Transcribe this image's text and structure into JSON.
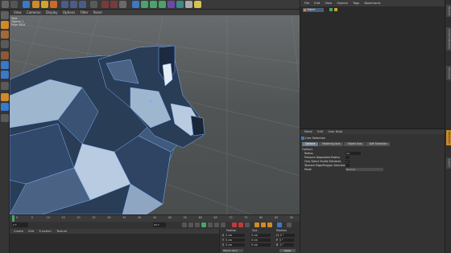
{
  "viewport": {
    "menu": [
      "View",
      "Cameras",
      "Display",
      "Options",
      "Filter",
      "Panel"
    ],
    "hud": [
      "Total",
      "Objects",
      "Polys"
    ],
    "hud_values": [
      "",
      "1",
      "3824"
    ]
  },
  "timeline": {
    "ticks": [
      "0",
      "5",
      "10",
      "15",
      "20",
      "25",
      "30",
      "35",
      "40",
      "45",
      "50",
      "55",
      "60",
      "65",
      "70",
      "75",
      "80",
      "85",
      "90"
    ],
    "current_frame": "0 F",
    "start_frame": "0 F",
    "end_frame": "90 F"
  },
  "material_menu": [
    "Create",
    "Edit",
    "Function",
    "Texture"
  ],
  "coords": {
    "headers": [
      "Position",
      "Size",
      "Rotation"
    ],
    "rows": [
      {
        "axis": "X",
        "pos": "0 cm",
        "size": "0 cm",
        "rot_label": "H",
        "rot": "0 °"
      },
      {
        "axis": "Y",
        "pos": "0 cm",
        "size": "0 cm",
        "rot_label": "P",
        "rot": "0 °"
      },
      {
        "axis": "Z",
        "pos": "0 cm",
        "size": "0 cm",
        "rot_label": "B",
        "rot": "0 °"
      }
    ],
    "mode": "Object (Rel)",
    "apply": "Apply"
  },
  "object_manager": {
    "menu": [
      "File",
      "Edit",
      "View",
      "Objects",
      "Tags",
      "Bookmarks"
    ],
    "header": "Object"
  },
  "attributes": {
    "menu": [
      "Mode",
      "Edit",
      "User Data"
    ],
    "title": "Live Selection",
    "tabs": [
      "Options",
      "Modeling Axis",
      "Object Axis",
      "Soft Selection"
    ],
    "section": "Options",
    "rows": [
      {
        "label": "Radius",
        "value": "10"
      },
      {
        "label": "Pressure Dependent Radius",
        "value": ""
      },
      {
        "label": "Only Select Visible Elements",
        "value": "✓"
      },
      {
        "label": "Tolerant Edge/Polygon Selection",
        "value": ""
      },
      {
        "label": "Mode",
        "value": "Normal"
      }
    ]
  },
  "right_strip": [
    "Objects",
    "Content Browser",
    "Structure",
    "Attributes",
    "Layers"
  ],
  "colors": {
    "accent": "#c58a2c",
    "mesh_dark": "#2a3d57",
    "mesh_light": "#b9cbe0",
    "wire": "#7fb3ff"
  }
}
